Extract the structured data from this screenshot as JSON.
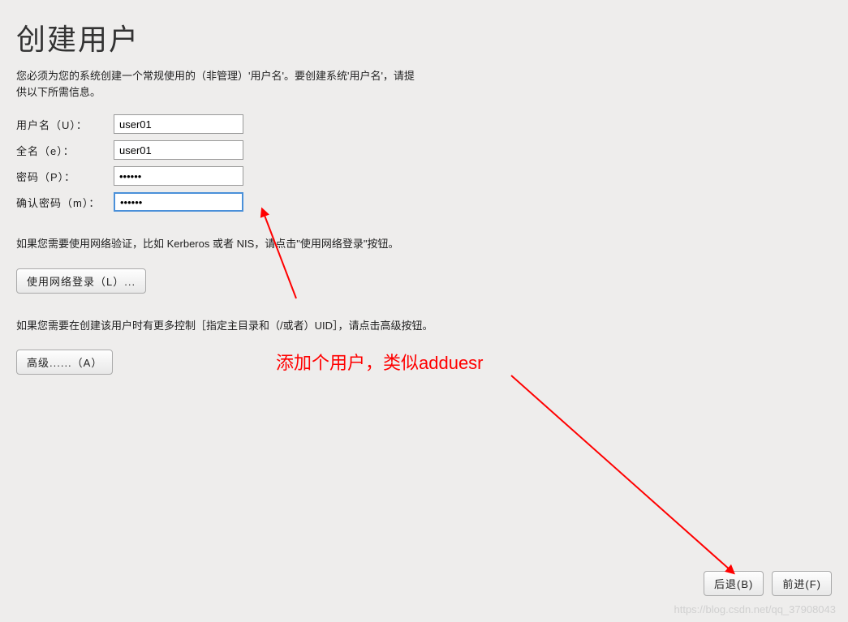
{
  "title": "创建用户",
  "description": "您必须为您的系统创建一个常规使用的（非管理）'用户名'。要创建系统'用户名'，请提供以下所需信息。",
  "form": {
    "username": {
      "label": "用户名（U）：",
      "value": "user01"
    },
    "fullname": {
      "label": "全名（e）：",
      "value": "user01"
    },
    "password": {
      "label": "密码（P）：",
      "value": "••••••"
    },
    "confirm_password": {
      "label": "确认密码（m）：",
      "value": "••••••"
    }
  },
  "network_info": "如果您需要使用网络验证，比如 Kerberos 或者 NIS，请点击\"使用网络登录\"按钮。",
  "network_button": "使用网络登录（L）...",
  "advanced_info": "如果您需要在创建该用户时有更多控制［指定主目录和（/或者）UID］，请点击高级按钮。",
  "advanced_button": "高级......（A）",
  "footer": {
    "back": "后退(B)",
    "forward": "前进(F)"
  },
  "annotation_text": "添加个用户，类似adduesr",
  "watermark": "https://blog.csdn.net/qq_37908043"
}
